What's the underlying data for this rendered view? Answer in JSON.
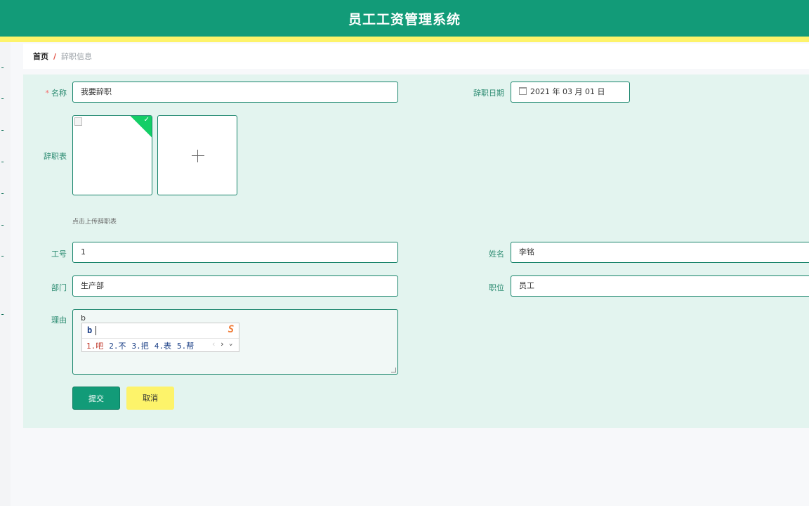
{
  "header": {
    "title": "员工工资管理系统"
  },
  "sidebar": {
    "items": [
      "--",
      "--",
      "--",
      "--",
      "--",
      "--",
      "--",
      "--"
    ]
  },
  "breadcrumb": {
    "home": "首页",
    "separator": "/",
    "current": "辞职信息"
  },
  "form": {
    "name": {
      "label": "名称",
      "required_mark": "*",
      "value": "我要辞职"
    },
    "resign_date": {
      "label": "辞职日期",
      "value": "2021 年 03 月 01 日"
    },
    "resign_form": {
      "label": "辞职表",
      "tip": "点击上传辞职表",
      "check": "✓",
      "plus": "+"
    },
    "employee_no": {
      "label": "工号",
      "value": "1"
    },
    "employee_name": {
      "label": "姓名",
      "value": "李铭"
    },
    "department": {
      "label": "部门",
      "value": "生产部"
    },
    "position": {
      "label": "职位",
      "value": "员工"
    },
    "reason": {
      "label": "理由",
      "value": "b"
    }
  },
  "ime": {
    "input": "b",
    "logo": "S",
    "candidates": [
      "1.吧",
      "2.不",
      "3.把",
      "4.表",
      "5.帮"
    ],
    "prev": "‹",
    "next": "›",
    "more": "⌄"
  },
  "buttons": {
    "submit": "提交",
    "cancel": "取消"
  }
}
